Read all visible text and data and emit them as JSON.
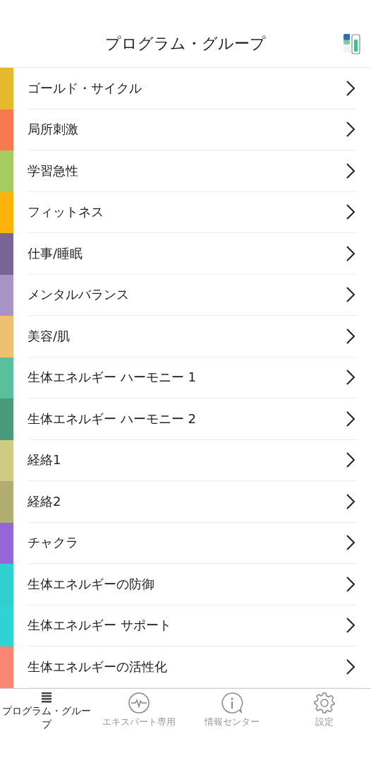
{
  "header": {
    "title": "プログラム・グループ"
  },
  "groups": [
    {
      "label": "ゴールド・サイクル",
      "color": "#e6b92f"
    },
    {
      "label": "局所刺激",
      "color": "#f7794f"
    },
    {
      "label": "学習急性",
      "color": "#a4cc62"
    },
    {
      "label": "フィットネス",
      "color": "#fdb50c"
    },
    {
      "label": "仕事/睡眠",
      "color": "#7a6598"
    },
    {
      "label": "メンタルバランス",
      "color": "#a893c6"
    },
    {
      "label": "美容/肌",
      "color": "#eec071"
    },
    {
      "label": "生体エネルギー ハーモニー 1",
      "color": "#58c09a"
    },
    {
      "label": "生体エネルギー ハーモニー 2",
      "color": "#4a9a7c"
    },
    {
      "label": "経絡1",
      "color": "#cfcb84"
    },
    {
      "label": "経絡2",
      "color": "#b1ac72"
    },
    {
      "label": "チャクラ",
      "color": "#9466d6"
    },
    {
      "label": "生体エネルギーの防御",
      "color": "#2fcfcf"
    },
    {
      "label": "生体エネルギー サポート",
      "color": "#2fd3d6"
    },
    {
      "label": "生体エネルギーの活性化",
      "color": "#f98773"
    }
  ],
  "tabs": [
    {
      "label": "プログラム・グループ",
      "selected": true
    },
    {
      "label": "エキスパート専用",
      "selected": false
    },
    {
      "label": "情報センター",
      "selected": false
    },
    {
      "label": "設定",
      "selected": false
    }
  ]
}
